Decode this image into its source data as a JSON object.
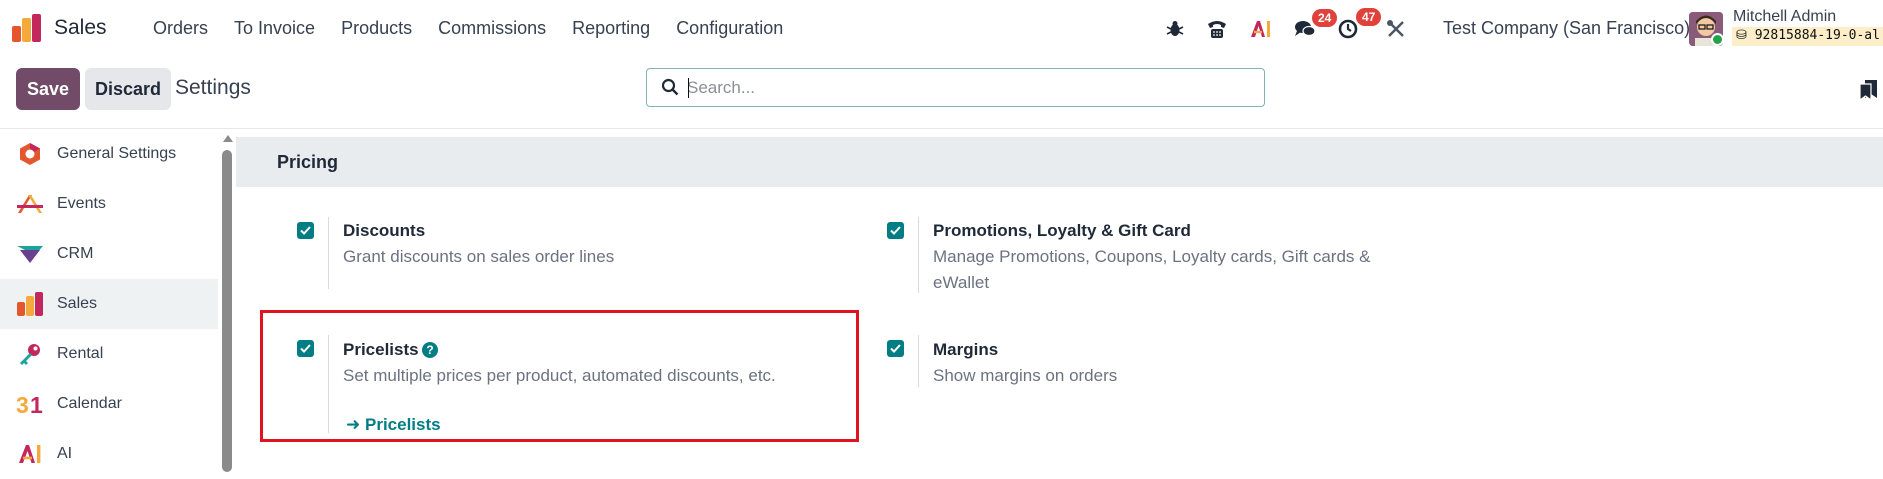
{
  "navbar": {
    "app_name": "Sales",
    "menu": [
      "Orders",
      "To Invoice",
      "Products",
      "Commissions",
      "Reporting",
      "Configuration"
    ],
    "icons": [
      "bug-icon",
      "phone-icon",
      "ai-icon",
      "chat-icon",
      "activity-clock-icon",
      "tools-icon"
    ],
    "messages_badge": "24",
    "activities_badge": "47",
    "company": "Test Company (San Francisco)",
    "user_name": "Mitchell Admin",
    "db_name": "92815884-19-0-al"
  },
  "control_panel": {
    "save_label": "Save",
    "discard_label": "Discard",
    "title": "Settings",
    "search_placeholder": "Search..."
  },
  "sidebar": {
    "items": [
      {
        "label": "General Settings",
        "icon": "general-settings-icon"
      },
      {
        "label": "Events",
        "icon": "events-icon"
      },
      {
        "label": "CRM",
        "icon": "crm-icon"
      },
      {
        "label": "Sales",
        "icon": "sales-icon",
        "active": true
      },
      {
        "label": "Rental",
        "icon": "rental-icon"
      },
      {
        "label": "Calendar",
        "icon": "calendar-icon"
      },
      {
        "label": "AI",
        "icon": "ai-icon"
      }
    ]
  },
  "pricing": {
    "section_title": "Pricing",
    "settings": [
      {
        "title": "Discounts",
        "description": "Grant discounts on sales order lines",
        "checked": true
      },
      {
        "title": "Promotions, Loyalty & Gift Card",
        "description": "Manage Promotions, Coupons, Loyalty cards, Gift cards & eWallet",
        "checked": true
      },
      {
        "title": "Pricelists",
        "description": "Set multiple prices per product, automated discounts, etc.",
        "checked": true,
        "link": "Pricelists",
        "help": "?"
      },
      {
        "title": "Margins",
        "description": "Show margins on orders",
        "checked": true
      }
    ]
  },
  "colors": {
    "brand": "#714b67",
    "accent": "#017e84",
    "highlight_box": "#e0141e"
  }
}
